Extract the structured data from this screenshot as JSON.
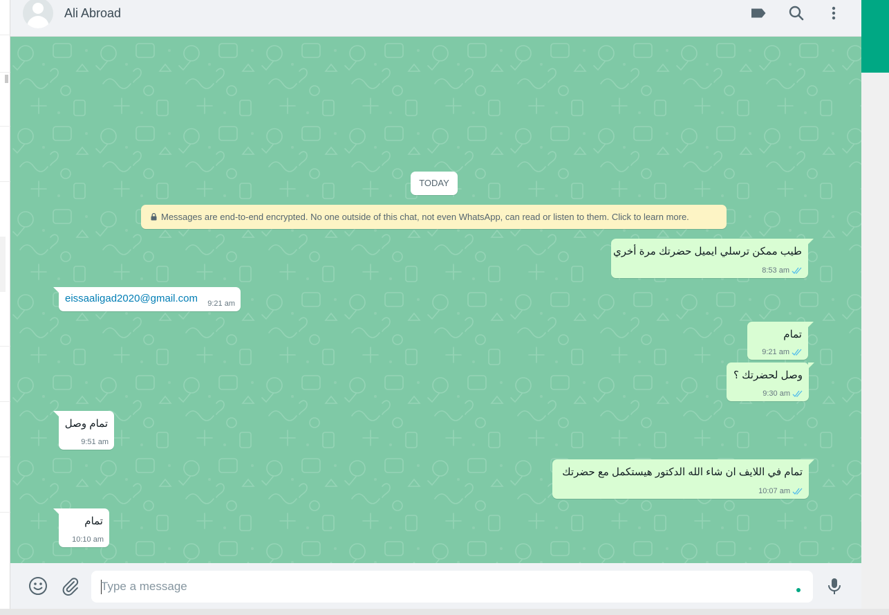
{
  "header": {
    "contact_name": "Ali Abroad"
  },
  "chat": {
    "date_label": "TODAY",
    "encryption_notice": "Messages are end-to-end encrypted. No one outside of this chat, not even WhatsApp, can read or listen to them. Click to learn more.",
    "messages": [
      {
        "direction": "outgoing",
        "text": "طيب ممكن ترسلي ايميل حضرتك مرة أخري",
        "time": "8:53 am",
        "status": "read"
      },
      {
        "direction": "incoming",
        "text": "eissaaligad2020@gmail.com",
        "time": "9:21 am"
      },
      {
        "direction": "outgoing",
        "text": "تمام",
        "time": "9:21 am",
        "status": "read"
      },
      {
        "direction": "outgoing",
        "text": "وصل لحضرتك ؟",
        "time": "9:30 am",
        "status": "read"
      },
      {
        "direction": "incoming",
        "text": "تمام وصل",
        "time": "9:51 am"
      },
      {
        "direction": "outgoing",
        "text": "تمام في اللايف ان شاء الله الدكتور هيستكمل مع حضرتك",
        "time": "10:07 am",
        "status": "read"
      },
      {
        "direction": "incoming",
        "text": "تمام",
        "time": "10:10 am"
      }
    ]
  },
  "composer": {
    "placeholder": "Type a message"
  },
  "colors": {
    "chat_background": "#7fc9a6",
    "outgoing_bubble": "#d9fdd3",
    "incoming_bubble": "#ffffff",
    "accent": "#00a884",
    "read_tick": "#53bdeb",
    "link": "#027eb5"
  },
  "icons": [
    "label-icon",
    "search-icon",
    "menu-icon",
    "emoji-icon",
    "attach-icon",
    "microphone-icon",
    "lock-icon",
    "double-tick-icon"
  ]
}
